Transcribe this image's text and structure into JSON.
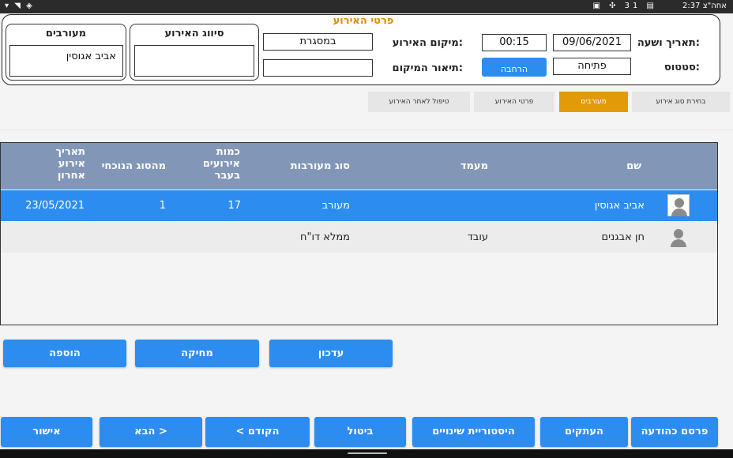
{
  "status_bar": {
    "time": "2:37",
    "ampm": "אחה\"צ",
    "left_icons": "▾ ◥ ◈",
    "right_icons": "▣ ✣ 31 ▤"
  },
  "header": {
    "title": "פרטי האירוע",
    "involved_title": "מעורבים",
    "involved_value": "אביב אגוסין",
    "classification_title": "סיווג האירוע",
    "classification_value": "",
    "location_label": "מיקום האירוע:",
    "location_value": "במסגרת",
    "location_desc_label": "תיאור המיקום:",
    "location_desc_value": "",
    "datetime_label": "תאריך ושעה:",
    "date_value": "09/06/2021",
    "time_value": "00:15",
    "status_label": "סטטוס:",
    "status_value": "פתיחה",
    "blue_button_label": "הרחבה"
  },
  "tabs": [
    {
      "label": "בחירת סוג אירוע",
      "active": false
    },
    {
      "label": "מעורבים",
      "active": true
    },
    {
      "label": "פרטי האירוע",
      "active": false
    },
    {
      "label": "טיפול לאחר האירוע",
      "active": false
    }
  ],
  "table": {
    "headers": {
      "name": "שם",
      "status": "מעמד",
      "involvement_type": "סוג מעורבות",
      "past_events": "כמות אירועים בעבר",
      "current_type": "מהסוג הנוכחי",
      "last_event_date": "תאריך אירוע אחרון"
    },
    "rows": [
      {
        "name": "אביב אגוסין",
        "status": "",
        "involvement_type": "מעורב",
        "past_events": "17",
        "current_type": "1",
        "last_event_date": "23/05/2021",
        "selected": true
      },
      {
        "name": "חן אבגנים",
        "status": "עובד",
        "involvement_type": "ממלא דו\"ח",
        "past_events": "",
        "current_type": "",
        "last_event_date": "",
        "selected": false
      }
    ]
  },
  "actions": {
    "add": "הוספה",
    "delete": "מחיקה",
    "update": "עדכון"
  },
  "footer": {
    "publish": "פרסם כהודעה",
    "copies": "העתקים",
    "history": "היסטוריית שינויים",
    "cancel": "ביטול",
    "prev": "< הקודם",
    "next": "הבא >",
    "approve": "אישור"
  },
  "colors": {
    "accent_blue": "#2d8cf0",
    "tab_active": "#e39a07",
    "table_header": "#8296b8",
    "selected_row": "#2d8cf0",
    "title_orange": "#e08a00"
  }
}
